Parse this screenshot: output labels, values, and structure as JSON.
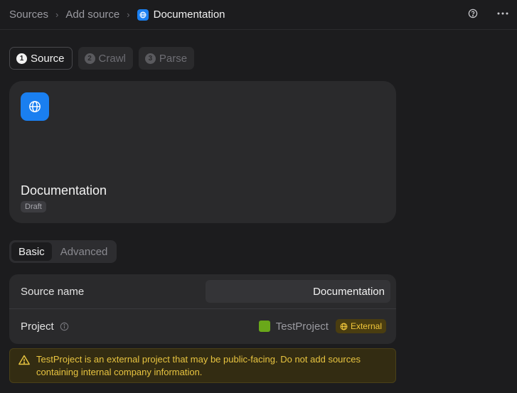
{
  "breadcrumb": {
    "items": [
      "Sources",
      "Add source"
    ],
    "current": "Documentation",
    "current_icon": "globe-icon"
  },
  "top_actions": {
    "help_icon": "help-circle-icon",
    "more_icon": "more-horizontal-icon"
  },
  "steps": [
    {
      "number": "1",
      "label": "Source",
      "active": true
    },
    {
      "number": "2",
      "label": "Crawl",
      "active": false
    },
    {
      "number": "3",
      "label": "Parse",
      "active": false
    }
  ],
  "source_card": {
    "icon": "globe-icon",
    "title": "Documentation",
    "status": "Draft"
  },
  "tabs": [
    {
      "label": "Basic",
      "active": true
    },
    {
      "label": "Advanced",
      "active": false
    }
  ],
  "form": {
    "source_name_label": "Source name",
    "source_name_value": "Documentation",
    "project_label": "Project",
    "project_name": "TestProject",
    "project_color": "#6aa81a",
    "project_badge": "External"
  },
  "warning": {
    "text": "TestProject is an external project that may be public-facing. Do not add sources containing internal company information."
  },
  "colors": {
    "accent": "#1a7ff0",
    "warning_text": "#e8c440",
    "background": "#1c1c1e"
  }
}
